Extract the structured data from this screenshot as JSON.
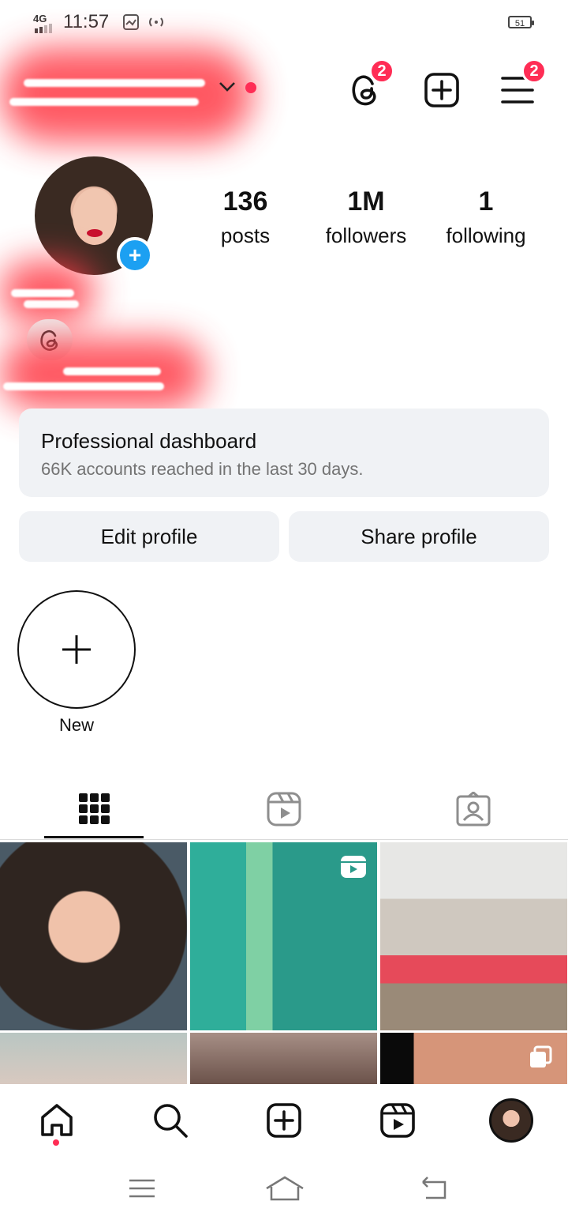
{
  "status_bar": {
    "network": "4G",
    "time": "11:57",
    "battery": "51"
  },
  "header": {
    "threads_badge": "2",
    "menu_badge": "2"
  },
  "stats": [
    {
      "num": "136",
      "label": "posts"
    },
    {
      "num": "1M",
      "label": "followers"
    },
    {
      "num": "1",
      "label": "following"
    }
  ],
  "dashboard": {
    "title": "Professional dashboard",
    "subtitle": "66K accounts reached in the last 30 days."
  },
  "buttons": {
    "edit": "Edit profile",
    "share": "Share profile"
  },
  "highlights": {
    "new_label": "New"
  },
  "tabs": [
    {
      "icon": "grid-icon"
    },
    {
      "icon": "reels-icon"
    },
    {
      "icon": "tagged-icon"
    }
  ],
  "bottom_nav": [
    "home-icon",
    "search-icon",
    "create-icon",
    "reels-icon",
    "profile-avatar"
  ],
  "colors": {
    "accent": "#1ca0f2",
    "badge": "#ff2d55",
    "surface": "#f0f2f5"
  }
}
